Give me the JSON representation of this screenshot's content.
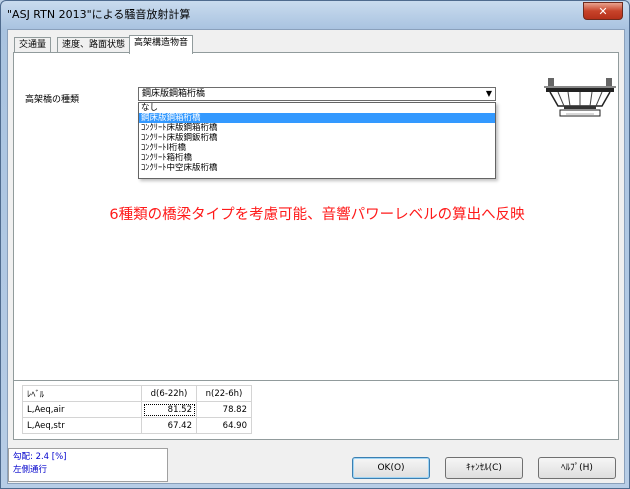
{
  "window": {
    "title": "\"ASJ RTN 2013\"による騒音放射計算",
    "close_label": "✕"
  },
  "tabs": [
    {
      "label": "交通量"
    },
    {
      "label": "速度、路面状態"
    },
    {
      "label": "高架構造物音"
    }
  ],
  "form": {
    "bridge_type_label": "高架橋の種類",
    "bridge_type_value": "鋼床版鋼箱桁橋",
    "options": [
      "なし",
      "鋼床版鋼箱桁橋",
      "ｺﾝｸﾘｰﾄ床版鋼箱桁橋",
      "ｺﾝｸﾘｰﾄ床版鋼鈑桁橋",
      "ｺﾝｸﾘｰﾄI桁橋",
      "ｺﾝｸﾘｰﾄ箱桁橋",
      "ｺﾝｸﾘｰﾄ中空床版桁橋"
    ],
    "selected_index": 1
  },
  "annotation": "6種類の橋梁タイプを考慮可能、音響パワーレベルの算出へ反映",
  "results": {
    "headers": [
      "ﾚﾍﾞﾙ",
      "d(6-22h)",
      "n(22-6h)"
    ],
    "rows": [
      {
        "label": "L,Aeq,air",
        "d": "81.52",
        "n": "78.82"
      },
      {
        "label": "L,Aeq,str",
        "d": "67.42",
        "n": "64.90"
      }
    ]
  },
  "status": {
    "line1": "勾配: 2.4 [%]",
    "line2": "左側通行"
  },
  "buttons": {
    "ok": "OK(O)",
    "cancel": "ｷｬﾝｾﾙ(C)",
    "help": "ﾍﾙﾌﾟ(H)"
  },
  "colors": {
    "accent": "#3399ff",
    "annotation": "#ff1a1a",
    "status_text": "#0000cc"
  },
  "icons": {
    "dropdown": "chevron-down-icon",
    "illustration": "bridge-cross-section-icon"
  }
}
